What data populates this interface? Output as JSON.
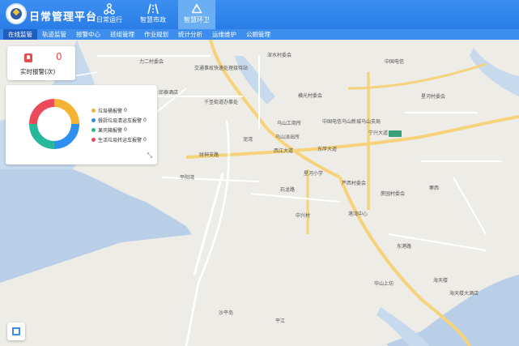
{
  "header": {
    "title": "日常管理平台",
    "modules": [
      {
        "label": "日常运行",
        "icon": "network-icon"
      },
      {
        "label": "智慧市政",
        "icon": "road-icon"
      },
      {
        "label": "智慧环卫",
        "icon": "recycle-icon",
        "active": true
      }
    ]
  },
  "subnav": {
    "items": [
      "在线监管",
      "轨迹监管",
      "报警中心",
      "班组管理",
      "作业规划",
      "统计分析",
      "运维维护",
      "公厕管理"
    ],
    "active_index": 0
  },
  "alarm": {
    "count": "0",
    "label": "实时报警(次)"
  },
  "stats": {
    "legend": [
      {
        "label": "垃圾桶报警",
        "value": "0",
        "color": "#f5b335"
      },
      {
        "label": "餐厨垃圾清运车报警",
        "value": "0",
        "color": "#2d8ff0"
      },
      {
        "label": "果壳箱报警",
        "value": "0",
        "color": "#26b89a"
      },
      {
        "label": "生活垃圾转运车报警",
        "value": "0",
        "color": "#ea4a5a"
      }
    ]
  },
  "map_labels": [
    "力二村委会",
    "邱泰酒店",
    "交通事故快速处理接待站",
    "千圣街道办事处",
    "深水村委会",
    "中国电信",
    "星河村委会",
    "横光村委会",
    "中国电信乌山新城乌山支局",
    "乌山工商所",
    "乌山派出所",
    "西江大道",
    "东岸大道",
    "泥湾",
    "平阳湾",
    "财神支路",
    "石龙路",
    "星河小学",
    "中兴村",
    "港湾中心",
    "芦西村委会",
    "蔗园村委会",
    "寨西",
    "海天楼",
    "海天楼大酒店",
    "东港路",
    "宁兴大道",
    "沙平岛",
    "平江",
    "华山上坊"
  ]
}
